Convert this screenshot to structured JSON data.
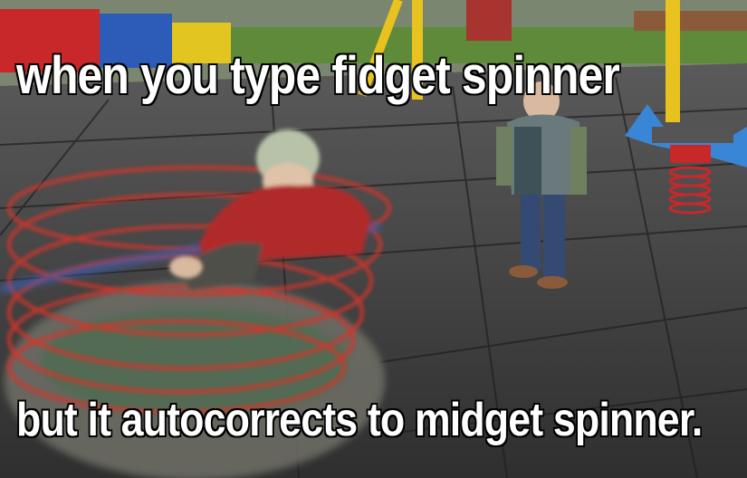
{
  "meme": {
    "top_text": "when you type  fidget spinner",
    "bottom_text": "but it autocorrects  to midget spinner."
  },
  "colors": {
    "ground": "#3d3d3d",
    "tile_line": "#1f1f1f",
    "grass": "#5f8a3a",
    "spinner_red": "#d4352c",
    "yellow_pole": "#e8c21e",
    "blue_seat": "#3a86d6",
    "caption_fill": "#ffffff",
    "caption_stroke": "#000000"
  }
}
